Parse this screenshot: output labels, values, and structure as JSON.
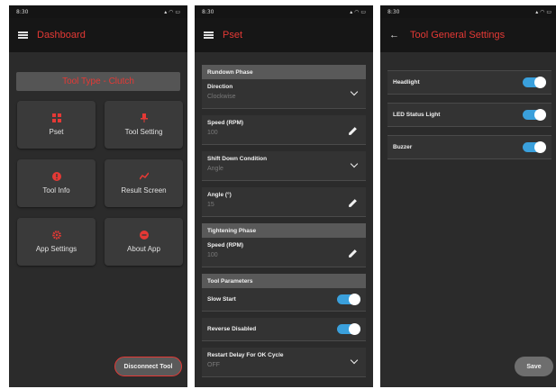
{
  "status": {
    "time": "8:30",
    "icons": "signal wifi battery"
  },
  "colors": {
    "accent": "#e53935",
    "toggle": "#3aa0dc",
    "background": "#2b2b2b"
  },
  "dashboard": {
    "title": "Dashboard",
    "tool_type": "Tool Type - Clutch",
    "tiles": [
      {
        "label": "Pset",
        "icon": "grid-icon"
      },
      {
        "label": "Tool Setting",
        "icon": "pin-icon"
      },
      {
        "label": "Tool Info",
        "icon": "info-icon"
      },
      {
        "label": "Result Screen",
        "icon": "trend-icon"
      },
      {
        "label": "App Settings",
        "icon": "gear-icon"
      },
      {
        "label": "About App",
        "icon": "about-icon"
      }
    ],
    "disconnect_label": "Disconnect Tool"
  },
  "pset": {
    "title": "Pset",
    "rundown_phase": "Rundown Phase",
    "direction": {
      "label": "Direction",
      "value": "Clockwise"
    },
    "speed1": {
      "label": "Speed (RPM)",
      "value": "100"
    },
    "shift_down": {
      "label": "Shift Down Condition",
      "value": "Angle"
    },
    "angle": {
      "label": "Angle (°)",
      "value": "15"
    },
    "tightening_phase": "Tightening Phase",
    "speed2": {
      "label": "Speed (RPM)",
      "value": "100"
    },
    "tool_parameters": "Tool Parameters",
    "slow_start": {
      "label": "Slow Start",
      "on": true
    },
    "reverse_disabled": {
      "label": "Reverse Disabled",
      "on": true
    },
    "restart_delay": {
      "label": "Restart Delay For OK Cycle",
      "value": "OFF"
    }
  },
  "tool_settings": {
    "title": "Tool General Settings",
    "items": [
      {
        "label": "Headlight",
        "on": true
      },
      {
        "label": "LED Status Light",
        "on": true
      },
      {
        "label": "Buzzer",
        "on": true
      }
    ],
    "save_label": "Save"
  }
}
